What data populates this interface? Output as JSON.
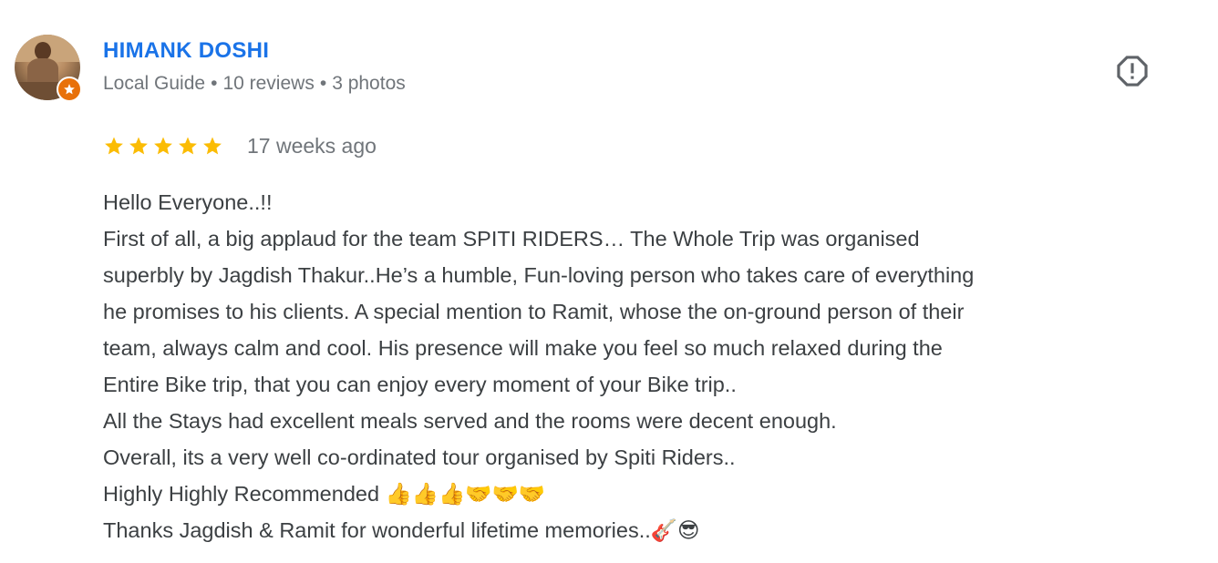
{
  "reviewer": {
    "name": "HIMANK DOSHI",
    "level": "Local Guide",
    "reviews": "10 reviews",
    "photos": "3 photos",
    "separator": "•"
  },
  "rating": {
    "stars": 5,
    "max_stars": 5,
    "time": "17 weeks ago"
  },
  "review_text": {
    "line1": "Hello Everyone..!!",
    "line2": "First of all, a big applaud for the team SPITI RIDERS… The Whole Trip was organised",
    "line3": "superbly by Jagdish Thakur..He’s a humble, Fun-loving person who takes care of everything",
    "line4": "he promises to his clients. A special mention to Ramit, whose the on-ground person of their",
    "line5": "team, always calm and cool. His presence will make you feel so much relaxed during the",
    "line6": "Entire Bike trip, that you can enjoy every moment of your Bike trip..",
    "line7": "All the Stays had excellent meals served and the rooms were decent enough.",
    "line8": "Overall, its a very well co-ordinated tour organised by Spiti Riders..",
    "line9": "Highly Highly Recommended ",
    "line9_emoji": "👍👍👍🤝🤝🤝",
    "line10": "Thanks Jagdish & Ramit for wonderful lifetime memories..",
    "line10_emoji": "🎸😎"
  },
  "icons": {
    "badge": "local-guide-star-icon",
    "report": "report-exclamation-icon",
    "star": "star-icon"
  },
  "colors": {
    "name": "#1a73e8",
    "meta": "#70757a",
    "star": "#fbbc04",
    "badge": "#e8710a",
    "text": "#3c4043",
    "report_icon": "#5f6368"
  }
}
